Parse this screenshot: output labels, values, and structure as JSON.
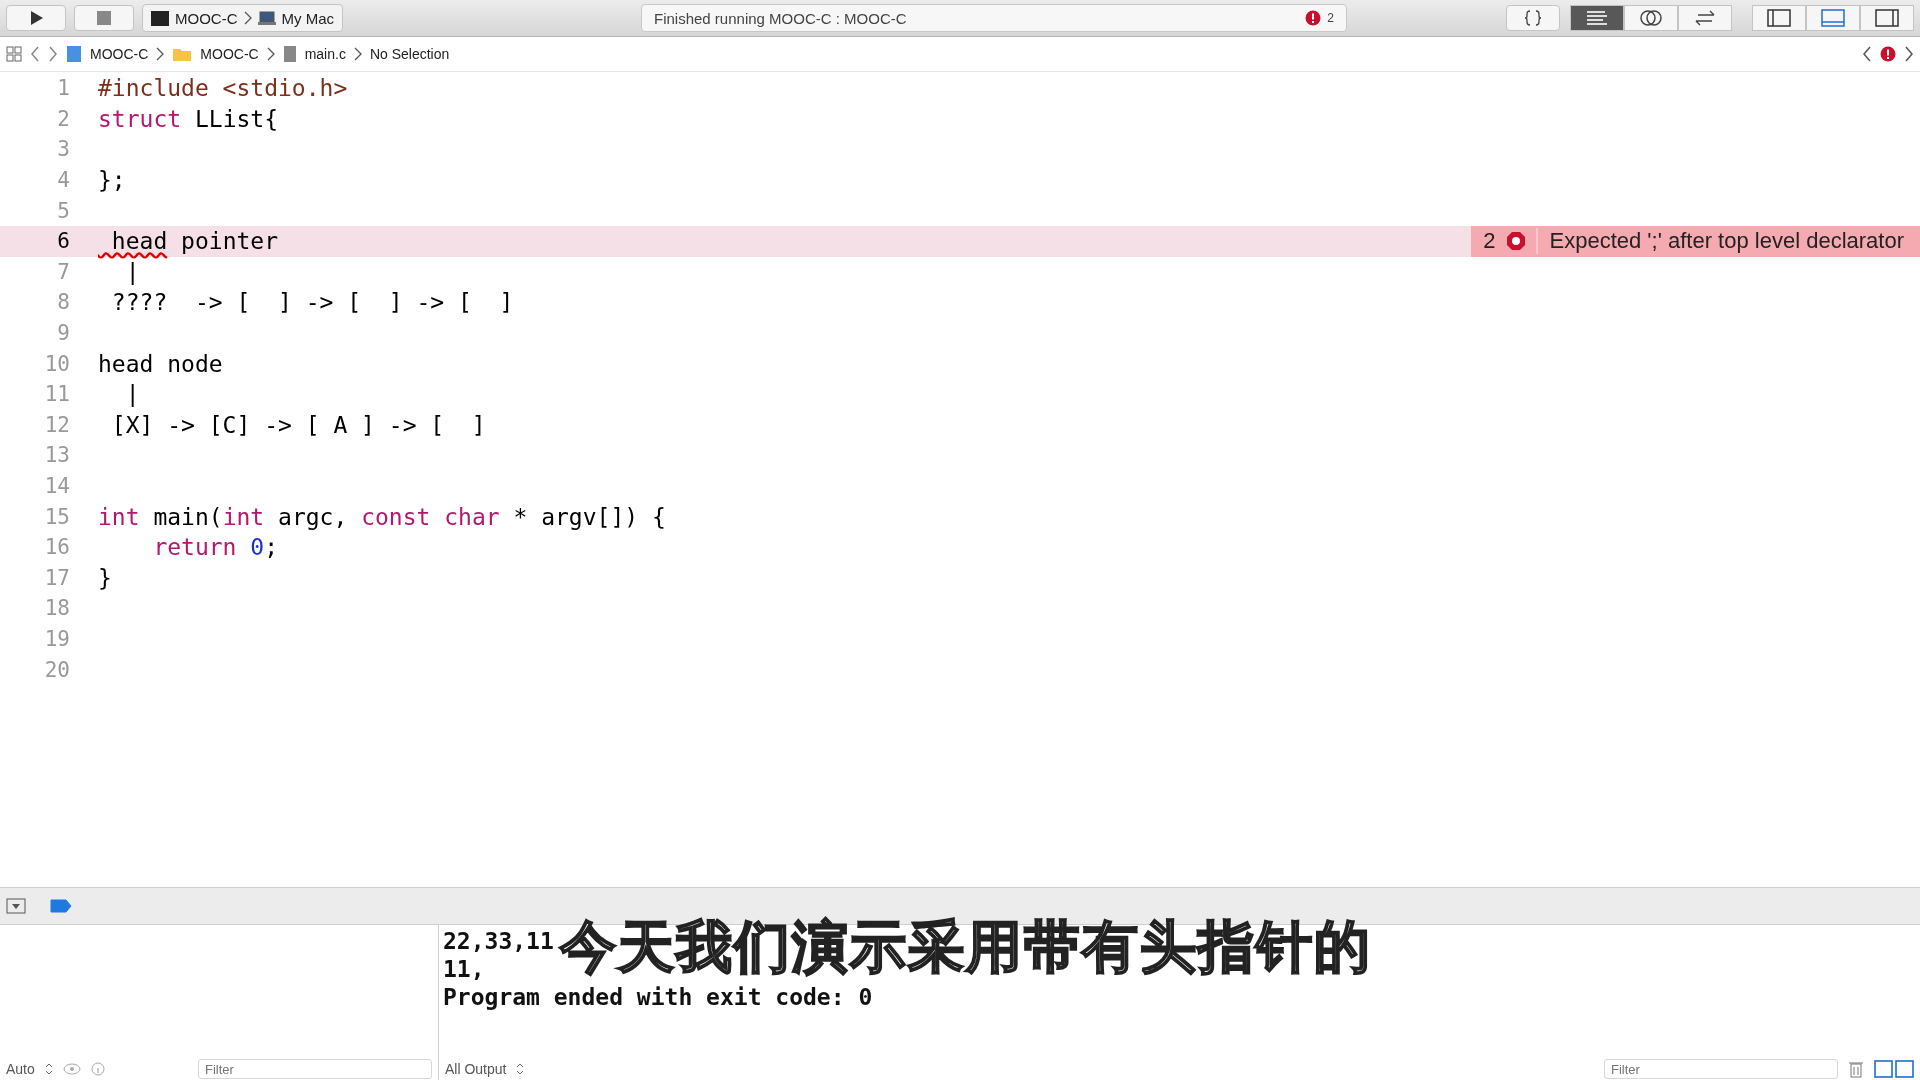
{
  "toolbar": {
    "scheme": [
      "MOOC-C",
      "My Mac"
    ],
    "activity": "Finished running MOOC-C : MOOC-C",
    "error_count": "2",
    "editor_modes": [
      {
        "kind": "braces",
        "selected": false
      },
      {
        "kind": "standard",
        "selected": true
      },
      {
        "kind": "assistant",
        "selected": false
      },
      {
        "kind": "version",
        "selected": false
      }
    ],
    "panels": [
      {
        "kind": "left",
        "on": false
      },
      {
        "kind": "bottom",
        "on": true
      },
      {
        "kind": "right",
        "on": false
      }
    ]
  },
  "jump_bar": [
    {
      "kind": "project",
      "label": "MOOC-C"
    },
    {
      "kind": "folder",
      "label": "MOOC-C"
    },
    {
      "kind": "file",
      "label": "main.c"
    },
    {
      "kind": "plain",
      "label": "No Selection"
    }
  ],
  "editor": {
    "lines": [
      {
        "number": "1",
        "current": false,
        "tokens": [
          {
            "kind": "preproc",
            "text": "#include <stdio.h>"
          }
        ]
      },
      {
        "number": "2",
        "current": false,
        "tokens": [
          {
            "kind": "keyword",
            "text": "struct"
          },
          {
            "kind": "plain",
            "text": " LList{"
          }
        ]
      },
      {
        "number": "3",
        "current": false
      },
      {
        "number": "4",
        "current": false,
        "tokens": [
          {
            "kind": "plain",
            "text": "};"
          }
        ]
      },
      {
        "number": "5",
        "current": false
      },
      {
        "number": "6",
        "current": true,
        "tokens": [
          {
            "kind": "error",
            "text": " head"
          },
          {
            "kind": "plain",
            "text": " pointer"
          }
        ],
        "issue": {
          "count": "2",
          "message": "Expected ';' after top level declarator"
        }
      },
      {
        "number": "7",
        "current": false,
        "tokens": [
          {
            "kind": "plain",
            "text": "  |"
          }
        ]
      },
      {
        "number": "8",
        "current": false,
        "tokens": [
          {
            "kind": "plain",
            "text": " ????  -> [  ] -> [  ] -> [  ]"
          }
        ]
      },
      {
        "number": "9",
        "current": false
      },
      {
        "number": "10",
        "current": false,
        "tokens": [
          {
            "kind": "plain",
            "text": "head node"
          }
        ]
      },
      {
        "number": "11",
        "current": false,
        "tokens": [
          {
            "kind": "plain",
            "text": "  |"
          }
        ]
      },
      {
        "number": "12",
        "current": false,
        "tokens": [
          {
            "kind": "plain",
            "text": " [X] -> [C] -> [ A ] -> [  ]"
          }
        ]
      },
      {
        "number": "13",
        "current": false
      },
      {
        "number": "14",
        "current": false
      },
      {
        "number": "15",
        "current": false,
        "tokens": [
          {
            "kind": "keyword",
            "text": "int"
          },
          {
            "kind": "plain",
            "text": " main("
          },
          {
            "kind": "keyword",
            "text": "int"
          },
          {
            "kind": "plain",
            "text": " argc, "
          },
          {
            "kind": "keyword",
            "text": "const char"
          },
          {
            "kind": "plain",
            "text": " * argv[]) {"
          }
        ]
      },
      {
        "number": "16",
        "current": false,
        "tokens": [
          {
            "kind": "keyword",
            "text": "    return"
          },
          {
            "kind": "number",
            "text": " 0"
          },
          {
            "kind": "plain",
            "text": ";"
          }
        ]
      },
      {
        "number": "17",
        "current": false,
        "tokens": [
          {
            "kind": "plain",
            "text": "}"
          }
        ]
      },
      {
        "number": "18",
        "current": false
      },
      {
        "number": "19",
        "current": false
      },
      {
        "number": "20",
        "current": false
      }
    ]
  },
  "debug_bar": {
    "breakpoints_on": true
  },
  "console": {
    "lines": [
      "22,33,11",
      "11,",
      "Program ended with exit code: 0"
    ]
  },
  "bottom_bar": {
    "variables_scope": "Auto",
    "variables_filter": {
      "placeholder": "Filter"
    },
    "output_scope": "All Output",
    "console_filter": {
      "placeholder": "Filter"
    }
  },
  "subtitle": "今天我们演示采用带有头指针的"
}
